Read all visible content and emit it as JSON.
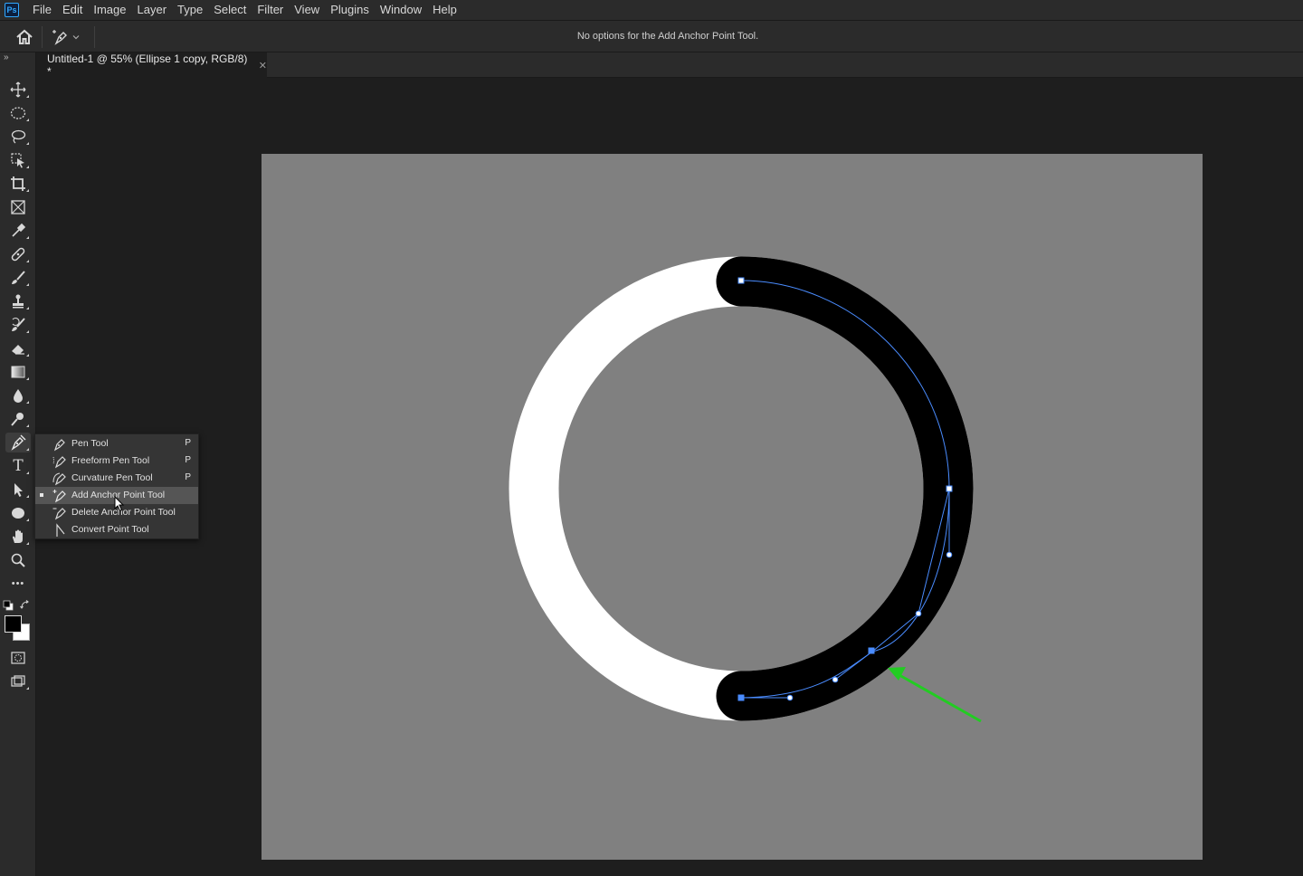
{
  "app": {
    "logo": "Ps"
  },
  "menu": [
    "File",
    "Edit",
    "Image",
    "Layer",
    "Type",
    "Select",
    "Filter",
    "View",
    "Plugins",
    "Window",
    "Help"
  ],
  "options_bar": {
    "message": "No options for the Add Anchor Point Tool."
  },
  "document": {
    "tab_title": "Untitled-1 @ 55% (Ellipse 1 copy, RGB/8) *",
    "close_glyph": "✕"
  },
  "toolbar": {
    "collapse_glyph": "»",
    "tools": [
      {
        "name": "move-tool",
        "icon": "move-icon"
      },
      {
        "name": "elliptical-marquee-tool",
        "icon": "ellipse-marquee-icon"
      },
      {
        "name": "lasso-tool",
        "icon": "lasso-icon"
      },
      {
        "name": "object-selection-tool",
        "icon": "object-select-icon"
      },
      {
        "name": "crop-tool",
        "icon": "crop-icon"
      },
      {
        "name": "frame-tool",
        "icon": "frame-icon"
      },
      {
        "name": "eyedropper-tool",
        "icon": "eyedropper-icon"
      },
      {
        "name": "healing-brush-tool",
        "icon": "bandage-icon"
      },
      {
        "name": "brush-tool",
        "icon": "brush-icon"
      },
      {
        "name": "clone-stamp-tool",
        "icon": "stamp-icon"
      },
      {
        "name": "history-brush-tool",
        "icon": "history-brush-icon"
      },
      {
        "name": "eraser-tool",
        "icon": "eraser-icon"
      },
      {
        "name": "gradient-tool",
        "icon": "gradient-icon"
      },
      {
        "name": "blur-tool",
        "icon": "drop-icon"
      },
      {
        "name": "dodge-tool",
        "icon": "dodge-icon"
      },
      {
        "name": "pen-tool",
        "icon": "pen-icon"
      },
      {
        "name": "type-tool",
        "icon": "type-icon",
        "glyph": "T"
      },
      {
        "name": "path-selection-tool",
        "icon": "arrow-icon"
      },
      {
        "name": "ellipse-tool",
        "icon": "ellipse-icon"
      },
      {
        "name": "hand-tool",
        "icon": "hand-icon"
      },
      {
        "name": "zoom-tool",
        "icon": "zoom-icon"
      },
      {
        "name": "edit-toolbar",
        "icon": "more-icon",
        "glyph": "•••"
      }
    ],
    "colors": {
      "foreground": "#000000",
      "background": "#ffffff"
    }
  },
  "flyout": {
    "items": [
      {
        "label": "Pen Tool",
        "key": "P",
        "selected": false
      },
      {
        "label": "Freeform Pen Tool",
        "key": "P",
        "selected": false
      },
      {
        "label": "Curvature Pen Tool",
        "key": "P",
        "selected": false
      },
      {
        "label": "Add Anchor Point Tool",
        "key": "",
        "selected": true
      },
      {
        "label": "Delete Anchor Point Tool",
        "key": "",
        "selected": false
      },
      {
        "label": "Convert Point Tool",
        "key": "",
        "selected": false
      }
    ]
  },
  "canvas": {
    "background": "#808080",
    "ring_white": "#ffffff",
    "ring_black": "#000000",
    "path_color": "#4a8cff",
    "arrow_color": "#22cc22"
  }
}
